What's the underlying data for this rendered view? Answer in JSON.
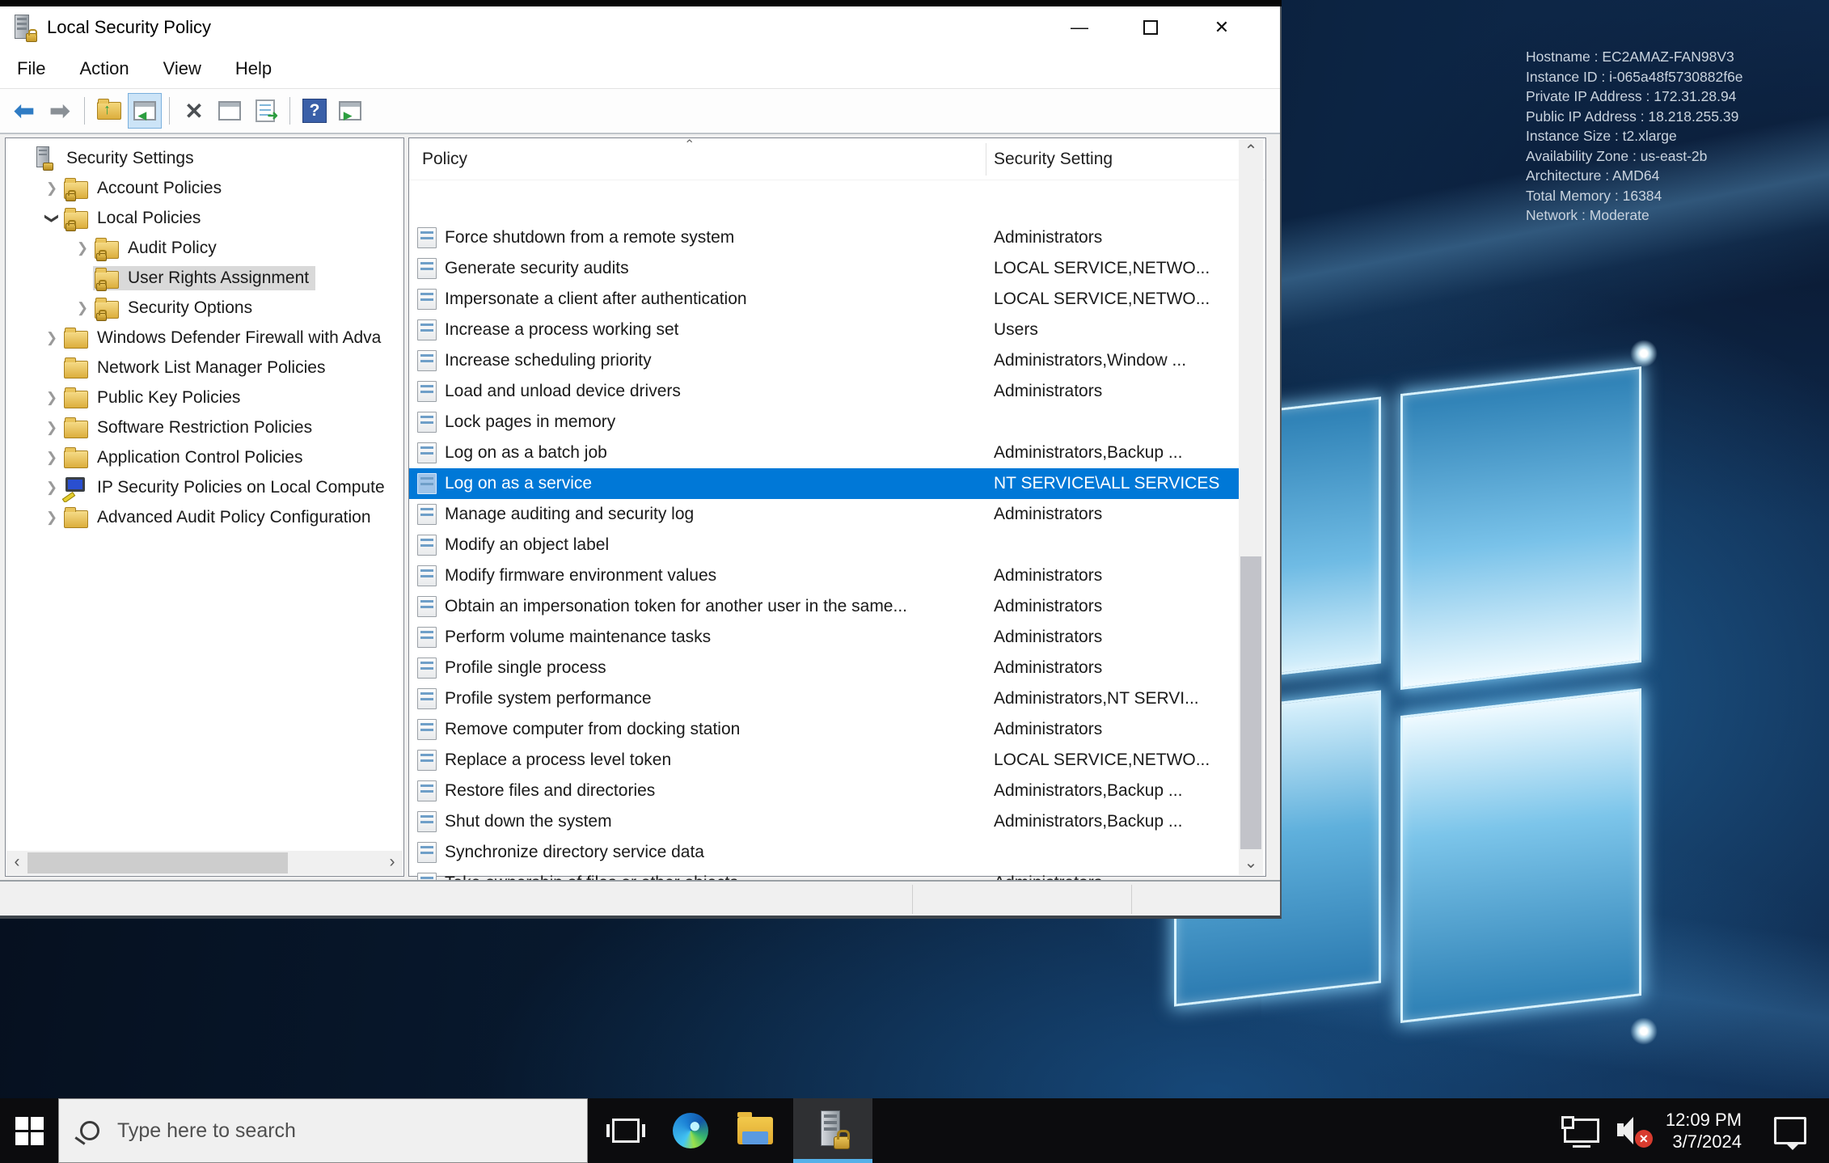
{
  "window": {
    "title": "Local Security Policy",
    "app_icon": "server-lock-icon",
    "controls": {
      "minimize": "—",
      "maximize": "maximize-box",
      "close": "✕"
    },
    "menu": [
      {
        "label": "File"
      },
      {
        "label": "Action"
      },
      {
        "label": "View"
      },
      {
        "label": "Help"
      }
    ],
    "toolbar_icons": [
      "back-arrow-icon",
      "forward-arrow-icon",
      "export-folder-icon",
      "show-console-tree-icon",
      "delete-icon",
      "properties-window-icon",
      "export-list-icon",
      "help-icon",
      "new-window-icon"
    ]
  },
  "tree": {
    "items": [
      {
        "label": "Security Settings",
        "level": 0,
        "expander": "none",
        "icon": "root",
        "selected": false
      },
      {
        "label": "Account Policies",
        "level": 1,
        "expander": "collapsed",
        "icon": "folder-lock",
        "selected": false
      },
      {
        "label": "Local Policies",
        "level": 1,
        "expander": "expanded",
        "icon": "folder-lock",
        "selected": false
      },
      {
        "label": "Audit Policy",
        "level": 2,
        "expander": "collapsed",
        "icon": "folder-lock",
        "selected": false
      },
      {
        "label": "User Rights Assignment",
        "level": 2,
        "expander": "none",
        "icon": "folder-lock",
        "selected": true
      },
      {
        "label": "Security Options",
        "level": 2,
        "expander": "collapsed",
        "icon": "folder-lock",
        "selected": false
      },
      {
        "label": "Windows Defender Firewall with Adva",
        "level": 1,
        "expander": "collapsed",
        "icon": "folder",
        "selected": false
      },
      {
        "label": "Network List Manager Policies",
        "level": 1,
        "expander": "none",
        "icon": "folder",
        "selected": false
      },
      {
        "label": "Public Key Policies",
        "level": 1,
        "expander": "collapsed",
        "icon": "folder",
        "selected": false
      },
      {
        "label": "Software Restriction Policies",
        "level": 1,
        "expander": "collapsed",
        "icon": "folder",
        "selected": false
      },
      {
        "label": "Application Control Policies",
        "level": 1,
        "expander": "collapsed",
        "icon": "folder",
        "selected": false
      },
      {
        "label": "IP Security Policies on Local Compute",
        "level": 1,
        "expander": "collapsed",
        "icon": "ipsec",
        "selected": false
      },
      {
        "label": "Advanced Audit Policy Configuration",
        "level": 1,
        "expander": "collapsed",
        "icon": "folder",
        "selected": false
      }
    ]
  },
  "list": {
    "columns": {
      "policy": "Policy",
      "setting": "Security Setting"
    },
    "sort_indicator": "⌃",
    "rows": [
      {
        "policy": "Force shutdown from a remote system",
        "setting": "Administrators",
        "selected": false
      },
      {
        "policy": "Generate security audits",
        "setting": "LOCAL SERVICE,NETWO...",
        "selected": false
      },
      {
        "policy": "Impersonate a client after authentication",
        "setting": "LOCAL SERVICE,NETWO...",
        "selected": false
      },
      {
        "policy": "Increase a process working set",
        "setting": "Users",
        "selected": false
      },
      {
        "policy": "Increase scheduling priority",
        "setting": "Administrators,Window ...",
        "selected": false
      },
      {
        "policy": "Load and unload device drivers",
        "setting": "Administrators",
        "selected": false
      },
      {
        "policy": "Lock pages in memory",
        "setting": "",
        "selected": false
      },
      {
        "policy": "Log on as a batch job",
        "setting": "Administrators,Backup ...",
        "selected": false
      },
      {
        "policy": "Log on as a service",
        "setting": "NT SERVICE\\ALL SERVICES",
        "selected": true
      },
      {
        "policy": "Manage auditing and security log",
        "setting": "Administrators",
        "selected": false
      },
      {
        "policy": "Modify an object label",
        "setting": "",
        "selected": false
      },
      {
        "policy": "Modify firmware environment values",
        "setting": "Administrators",
        "selected": false
      },
      {
        "policy": "Obtain an impersonation token for another user in the same...",
        "setting": "Administrators",
        "selected": false
      },
      {
        "policy": "Perform volume maintenance tasks",
        "setting": "Administrators",
        "selected": false
      },
      {
        "policy": "Profile single process",
        "setting": "Administrators",
        "selected": false
      },
      {
        "policy": "Profile system performance",
        "setting": "Administrators,NT SERVI...",
        "selected": false
      },
      {
        "policy": "Remove computer from docking station",
        "setting": "Administrators",
        "selected": false
      },
      {
        "policy": "Replace a process level token",
        "setting": "LOCAL SERVICE,NETWO...",
        "selected": false
      },
      {
        "policy": "Restore files and directories",
        "setting": "Administrators,Backup ...",
        "selected": false
      },
      {
        "policy": "Shut down the system",
        "setting": "Administrators,Backup ...",
        "selected": false
      },
      {
        "policy": "Synchronize directory service data",
        "setting": "",
        "selected": false
      },
      {
        "policy": "Take ownership of files or other objects",
        "setting": "Administrators",
        "selected": false
      }
    ]
  },
  "desktop": {
    "info_lines": [
      "Hostname : EC2AMAZ-FAN98V3",
      "Instance ID : i-065a48f5730882f6e",
      "Private IP Address : 172.31.28.94",
      "Public IP Address : 18.218.255.39",
      "Instance Size : t2.xlarge",
      "Availability Zone : us-east-2b",
      "Architecture : AMD64",
      "Total Memory : 16384",
      "Network : Moderate"
    ]
  },
  "taskbar": {
    "search_placeholder": "Type here to search",
    "icons": [
      "start-icon",
      "task-view-icon",
      "edge-icon",
      "file-explorer-icon",
      "local-security-policy-icon"
    ],
    "tray_icons": [
      "network-icon",
      "volume-muted-icon",
      "action-center-icon"
    ],
    "clock_time": "12:09 PM",
    "clock_date": "3/7/2024"
  },
  "colors": {
    "selection_blue": "#0078d7",
    "taskbar_black": "#0c0c0e",
    "active_task_underline": "#55b0e8",
    "tree_inactive_selection": "#d9d9d9"
  }
}
